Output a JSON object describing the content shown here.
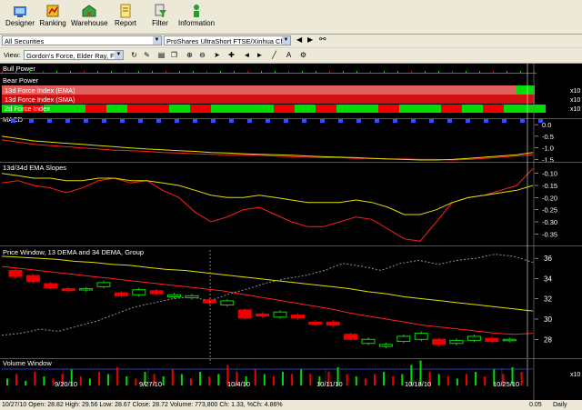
{
  "toolbar": {
    "buttons": [
      {
        "label": "Designer",
        "icon": "designer-icon"
      },
      {
        "label": "Ranking",
        "icon": "ranking-icon"
      },
      {
        "label": "Warehouse",
        "icon": "warehouse-icon"
      },
      {
        "label": "Report",
        "icon": "report-icon"
      },
      {
        "label": "Filter",
        "icon": "filter-icon"
      },
      {
        "label": "Information",
        "icon": "information-icon"
      }
    ]
  },
  "selectors": {
    "list": "All Securities",
    "security": "ProShares UltraShort FTSE/Xinhua China",
    "view_label": "View:",
    "view": "Gordon's Force, Elder Ray, FI, 1"
  },
  "colors": {
    "up": "#00dd00",
    "down": "#ee0000",
    "ema_fast": "#ff2020",
    "ema_slow": "#e0e000",
    "grid": "#444444"
  },
  "panes": {
    "bull_power": "Bull Power",
    "bear_power": "Bear Power",
    "fi13_ema": "13d Force Index (EMA)",
    "fi13_sma": "13d Force Index (SMA)",
    "fi2": "2d Force Index",
    "macd": "MACD",
    "slopes": "13d/34d EMA Slopes",
    "price": "Price Window, 13 DEMA and 34 DEMA, Group",
    "volume": "Volume Window",
    "x10_label": "x10"
  },
  "chart_data": [
    {
      "type": "line",
      "title": "MACD",
      "ylim": [
        -1.6,
        0.2
      ],
      "ticks": [
        "0.0",
        "-0.5",
        "-1.0",
        "-1.5"
      ],
      "tick_values": [
        0.0,
        -0.5,
        -1.0,
        -1.5
      ],
      "series": [
        {
          "values": [
            -0.65,
            -0.75,
            -0.85,
            -0.9,
            -0.95,
            -1.0,
            -1.05,
            -1.1,
            -1.12,
            -1.15,
            -1.2,
            -1.22,
            -1.25,
            -1.28,
            -1.3,
            -1.3,
            -1.32,
            -1.35,
            -1.38,
            -1.4,
            -1.42,
            -1.42,
            -1.45,
            -1.45,
            -1.48,
            -1.48,
            -1.5,
            -1.5,
            -1.52,
            -1.5,
            -1.45,
            -1.4,
            -1.35,
            -1.3
          ]
        },
        {
          "values": [
            -0.5,
            -0.6,
            -0.7,
            -0.75,
            -0.8,
            -0.85,
            -0.9,
            -0.95,
            -1.0,
            -1.05,
            -1.08,
            -1.12,
            -1.15,
            -1.2,
            -1.22,
            -1.25,
            -1.28,
            -1.3,
            -1.32,
            -1.35,
            -1.38,
            -1.4,
            -1.42,
            -1.45,
            -1.48,
            -1.5,
            -1.52,
            -1.52,
            -1.5,
            -1.45,
            -1.4,
            -1.35,
            -1.3,
            -1.2
          ]
        }
      ]
    },
    {
      "type": "line",
      "title": "13d/34d EMA Slopes",
      "ylim": [
        -0.39,
        -0.06
      ],
      "ticks": [
        "-0.10",
        "-0.15",
        "-0.20",
        "-0.25",
        "-0.30",
        "-0.35"
      ],
      "tick_values": [
        -0.1,
        -0.15,
        -0.2,
        -0.25,
        -0.3,
        -0.35
      ],
      "series": [
        {
          "values": [
            -0.14,
            -0.13,
            -0.15,
            -0.16,
            -0.18,
            -0.16,
            -0.13,
            -0.12,
            -0.14,
            -0.13,
            -0.17,
            -0.2,
            -0.26,
            -0.3,
            -0.28,
            -0.25,
            -0.24,
            -0.27,
            -0.3,
            -0.32,
            -0.32,
            -0.3,
            -0.28,
            -0.29,
            -0.33,
            -0.37,
            -0.38,
            -0.3,
            -0.22,
            -0.2,
            -0.19,
            -0.17,
            -0.15,
            -0.08
          ]
        },
        {
          "values": [
            -0.1,
            -0.11,
            -0.12,
            -0.12,
            -0.13,
            -0.13,
            -0.12,
            -0.12,
            -0.13,
            -0.13,
            -0.14,
            -0.15,
            -0.17,
            -0.19,
            -0.2,
            -0.2,
            -0.19,
            -0.2,
            -0.21,
            -0.22,
            -0.22,
            -0.22,
            -0.21,
            -0.22,
            -0.24,
            -0.27,
            -0.27,
            -0.25,
            -0.22,
            -0.2,
            -0.19,
            -0.18,
            -0.17,
            -0.15
          ]
        }
      ]
    },
    {
      "type": "line",
      "title": "Price Window, 13 DEMA and 34 DEMA, Group",
      "ylim": [
        26.5,
        37
      ],
      "ticks": [
        "36",
        "34",
        "32",
        "30",
        "28"
      ],
      "tick_values": [
        36,
        34,
        32,
        30,
        28
      ],
      "candles": [
        {
          "o": 34.8,
          "c": 34.2
        },
        {
          "o": 34.3,
          "c": 33.7
        },
        {
          "o": 33.5,
          "c": 33.1
        },
        {
          "o": 33.0,
          "c": 32.8
        },
        {
          "o": 32.9,
          "c": 33.0
        },
        {
          "o": 33.2,
          "c": 33.6
        },
        {
          "o": 32.6,
          "c": 32.3
        },
        {
          "o": 32.4,
          "c": 32.9
        },
        {
          "o": 32.8,
          "c": 32.5
        },
        {
          "o": 32.2,
          "c": 32.4
        },
        {
          "o": 32.1,
          "c": 32.3
        },
        {
          "o": 31.9,
          "c": 31.6
        },
        {
          "o": 31.4,
          "c": 31.8
        },
        {
          "o": 30.9,
          "c": 30.1
        },
        {
          "o": 30.5,
          "c": 30.3
        },
        {
          "o": 30.2,
          "c": 30.7
        },
        {
          "o": 30.4,
          "c": 30.1
        },
        {
          "o": 29.7,
          "c": 29.5
        },
        {
          "o": 29.7,
          "c": 29.4
        },
        {
          "o": 28.5,
          "c": 28.0
        },
        {
          "o": 27.6,
          "c": 28.0
        },
        {
          "o": 27.3,
          "c": 27.5
        },
        {
          "o": 27.8,
          "c": 28.3
        },
        {
          "o": 28.0,
          "c": 28.6
        },
        {
          "o": 28.0,
          "c": 27.5
        },
        {
          "o": 27.6,
          "c": 27.9
        },
        {
          "o": 27.9,
          "c": 28.3
        },
        {
          "o": 28.1,
          "c": 27.8
        },
        {
          "o": 28.0,
          "c": 28.0
        }
      ],
      "series": [
        {
          "values": [
            35.2,
            35.0,
            34.8,
            34.6,
            34.4,
            34.2,
            34.0,
            33.8,
            33.6,
            33.4,
            33.2,
            33.0,
            32.8,
            32.5,
            32.2,
            31.9,
            31.6,
            31.3,
            31.0,
            30.6,
            30.3,
            30.0,
            29.7,
            29.4,
            29.2,
            29.0,
            28.8,
            28.6,
            28.5,
            28.6
          ]
        },
        {
          "values": [
            36.2,
            36.1,
            36.0,
            35.9,
            35.7,
            35.6,
            35.4,
            35.3,
            35.1,
            34.9,
            34.8,
            34.6,
            34.4,
            34.2,
            34.0,
            33.8,
            33.6,
            33.4,
            33.2,
            33.0,
            32.7,
            32.5,
            32.2,
            32.0,
            31.8,
            31.6,
            31.4,
            31.2,
            31.0,
            30.8
          ]
        },
        {
          "values": [
            28.4,
            28.6,
            29.0,
            28.8,
            29.3,
            29.8,
            30.5,
            31.2,
            31.6,
            32.0,
            32.2,
            31.8,
            32.5,
            33.0,
            33.6,
            34.0,
            34.3,
            34.8,
            35.5,
            35.2,
            34.8,
            35.5,
            35.8,
            35.4,
            35.8,
            36.0,
            36.4,
            36.2,
            35.6
          ]
        }
      ]
    },
    {
      "type": "bar",
      "title": "Volume Window",
      "ylim": [
        0,
        1.2
      ],
      "values": [
        0.3,
        0.5,
        0.2,
        0.6,
        0.4,
        0.3,
        0.5,
        0.7,
        0.4,
        0.3,
        0.6,
        0.5,
        0.8,
        0.4,
        0.3,
        0.6,
        0.5,
        0.4,
        0.7,
        0.5,
        0.3,
        0.6,
        0.4,
        0.5,
        0.9,
        0.6,
        0.4,
        0.7,
        0.5,
        0.4,
        0.6,
        0.5,
        0.7,
        0.5,
        0.4,
        0.6,
        0.8,
        0.5,
        0.4,
        0.3,
        0.5,
        0.6,
        0.4,
        0.5,
        0.9,
        1.1,
        0.6,
        0.5,
        0.4,
        0.3,
        0.5,
        0.6,
        0.4,
        0.7,
        0.5,
        0.8,
        0.6
      ],
      "colors": [
        "up",
        "down",
        "up",
        "down",
        "up",
        "down",
        "down",
        "up",
        "down",
        "up",
        "down",
        "up",
        "down",
        "up",
        "down",
        "up",
        "down",
        "up",
        "down",
        "up",
        "down",
        "up",
        "down",
        "up",
        "down",
        "down",
        "up",
        "down",
        "up",
        "down",
        "up",
        "down",
        "up",
        "down",
        "up",
        "down",
        "up",
        "down",
        "up",
        "down",
        "down",
        "up",
        "down",
        "up",
        "up",
        "up",
        "down",
        "up",
        "down",
        "up",
        "down",
        "up",
        "down",
        "up",
        "down",
        "up",
        "down"
      ]
    }
  ],
  "xaxis": {
    "ticks": [
      "9/20/10",
      "9/27/10",
      "10/4/10",
      "10/11/10",
      "10/18/10",
      "10/25/10"
    ]
  },
  "status": {
    "summary": "10/27/10 Open: 28.82 High: 29.56 Low: 28.67 Close: 28.72 Volume: 773,800 Ch: 1.33, %Ch: 4.86%",
    "value": "0.05",
    "period": "Daily"
  }
}
